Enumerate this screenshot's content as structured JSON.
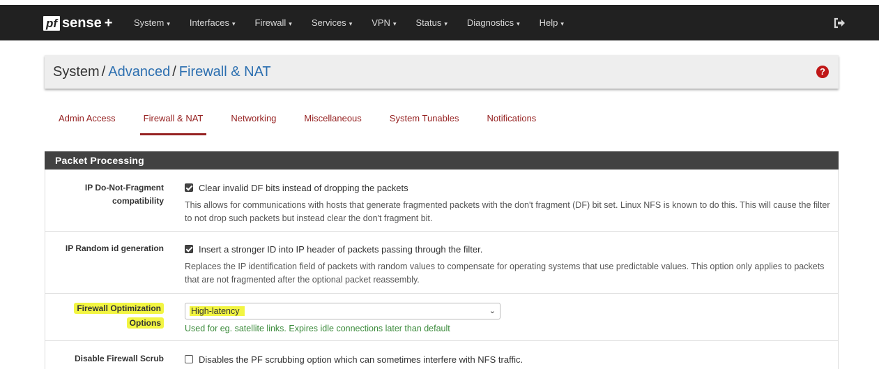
{
  "brand": {
    "logo_mark": "pf",
    "logo_text": "sense",
    "logo_plus": "+"
  },
  "nav": {
    "items": [
      {
        "label": "System"
      },
      {
        "label": "Interfaces"
      },
      {
        "label": "Firewall"
      },
      {
        "label": "Services"
      },
      {
        "label": "VPN"
      },
      {
        "label": "Status"
      },
      {
        "label": "Diagnostics"
      },
      {
        "label": "Help"
      }
    ],
    "caret": "▾",
    "logout_icon": "logout-icon"
  },
  "breadcrumb": {
    "root": "System",
    "sep": "/",
    "level1": "Advanced",
    "level2": "Firewall & NAT",
    "help_glyph": "?"
  },
  "tabs": [
    {
      "label": "Admin Access",
      "active": false
    },
    {
      "label": "Firewall & NAT",
      "active": true
    },
    {
      "label": "Networking",
      "active": false
    },
    {
      "label": "Miscellaneous",
      "active": false
    },
    {
      "label": "System Tunables",
      "active": false
    },
    {
      "label": "Notifications",
      "active": false
    }
  ],
  "section": {
    "title": "Packet Processing",
    "rows": [
      {
        "label_line1": "IP Do-Not-Fragment",
        "label_line2": "compatibility",
        "checkbox_label": "Clear invalid DF bits instead of dropping the packets",
        "checked": true,
        "description": "This allows for communications with hosts that generate fragmented packets with the don't fragment (DF) bit set. Linux NFS is known to do this. This will cause the filter to not drop such packets but instead clear the don't fragment bit."
      },
      {
        "label_line1": "IP Random id generation",
        "checkbox_label": "Insert a stronger ID into IP header of packets passing through the filter.",
        "checked": true,
        "description": "Replaces the IP identification field of packets with random values to compensate for operating systems that use predictable values. This option only applies to packets that are not fragmented after the optional packet reassembly."
      },
      {
        "label_line1": "Firewall Optimization",
        "label_line2": "Options",
        "select_value": "High-latency",
        "select_caret": "⌄",
        "help_text": "Used for eg. satellite links. Expires idle connections later than default",
        "highlight_color": "#f2f542"
      },
      {
        "label_line1": "Disable Firewall Scrub",
        "checkbox_label": "Disables the PF scrubbing option which can sometimes interfere with NFS traffic.",
        "checked": false
      }
    ]
  },
  "colors": {
    "navbar": "#212121",
    "accent_tab": "#962222",
    "link": "#2c6fb0",
    "panel_header": "#424242",
    "help_green": "#3a8a3a",
    "help_icon": "#c01717"
  }
}
